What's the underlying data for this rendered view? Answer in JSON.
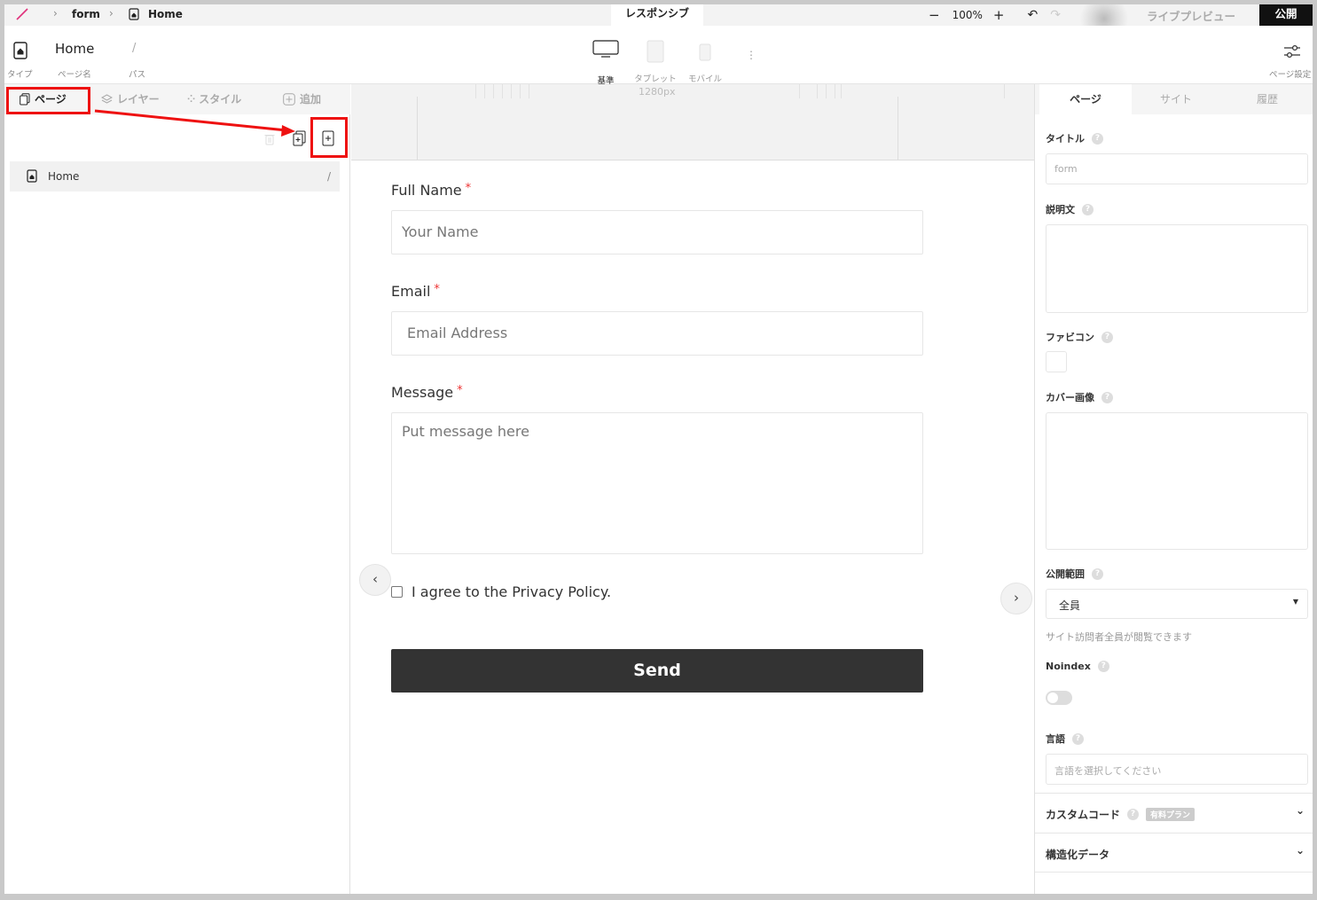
{
  "topbar": {
    "breadcrumb": [
      "form",
      "Home"
    ],
    "center_tab": "レスポンシブ",
    "zoom_level": "100%",
    "live_preview": "ライブプレビュー",
    "publish": "公開"
  },
  "page_bar": {
    "type_label": "タイプ",
    "page_name": "Home",
    "page_name_label": "ページ名",
    "path": "/",
    "path_label": "パス",
    "devices": [
      "基準",
      "タブレット",
      "モバイル"
    ],
    "page_settings_label": "ページ設定"
  },
  "left_panel": {
    "tabs": [
      "ページ",
      "レイヤー",
      "スタイル",
      "追加"
    ],
    "pages": [
      {
        "name": "Home",
        "path": "/"
      }
    ]
  },
  "canvas": {
    "width_label": "1280px",
    "form": {
      "fields": [
        {
          "label": "Full Name",
          "required": "*",
          "placeholder": "Your Name"
        },
        {
          "label": "Email",
          "required": "*",
          "placeholder": "Email Address"
        },
        {
          "label": "Message",
          "required": "*",
          "placeholder": "Put message here"
        }
      ],
      "agree": "I agree to the Privacy Policy.",
      "submit": "Send"
    }
  },
  "right_panel": {
    "tabs": [
      "ページ",
      "サイト",
      "履歴"
    ],
    "title_label": "タイトル",
    "title_placeholder": "form",
    "description_label": "説明文",
    "favicon_label": "ファビコン",
    "cover_label": "カバー画像",
    "visibility_label": "公開範囲",
    "visibility_value": "全員",
    "visibility_hint": "サイト訪問者全員が閲覧できます",
    "noindex_label": "Noindex",
    "language_label": "言語",
    "language_placeholder": "言語を選択してください",
    "custom_code_label": "カスタムコード",
    "custom_code_badge": "有料プラン",
    "structured_data_label": "構造化データ"
  },
  "colors": {
    "accent_red": "#e11111",
    "logo": "#e0307a",
    "publish_bg": "#111111",
    "send_bg": "#333333"
  }
}
